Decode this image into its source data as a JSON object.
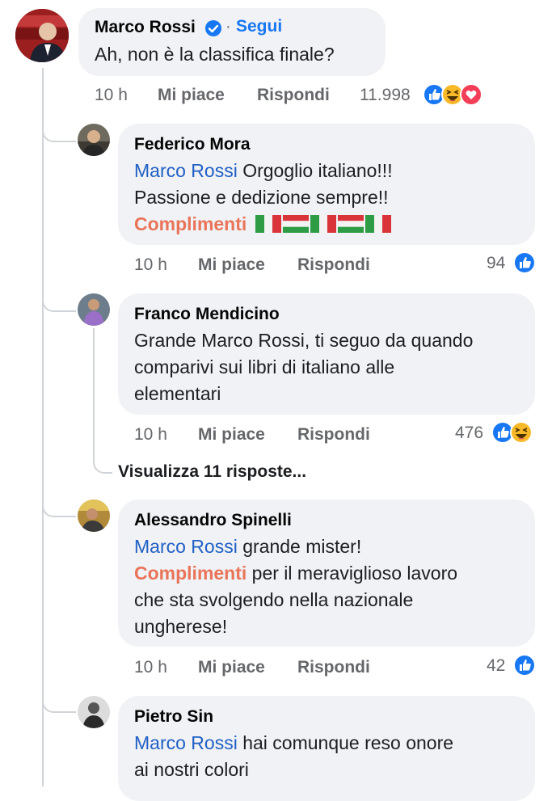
{
  "main_comment": {
    "author": "Marco Rossi",
    "dot": "·",
    "follow_label": "Segui",
    "text": "Ah, non è la classifica finale?",
    "time": "10 h",
    "like_label": "Mi piace",
    "reply_label": "Rispondi",
    "reactions_count": "11.998",
    "reactions": [
      "like-icon",
      "haha-icon",
      "love-icon"
    ]
  },
  "replies": [
    {
      "author": "Federico Mora",
      "mention": "Marco Rossi",
      "text_line1": " Orgoglio italiano!!!",
      "text_line2": "Passione e dedizione sempre!!",
      "highlight": "Complimenti",
      "time": "10 h",
      "like_label": "Mi piace",
      "reply_label": "Rispondi",
      "reactions_count": "94",
      "reactions": [
        "like-icon"
      ]
    },
    {
      "author": "Franco Mendicino",
      "text_line1": "Grande Marco Rossi, ti seguo da quando",
      "text_line2": "comparivi sui libri di italiano alle",
      "text_line3": "elementari",
      "time": "10 h",
      "like_label": "Mi piace",
      "reply_label": "Rispondi",
      "reactions_count": "476",
      "reactions": [
        "like-icon",
        "haha-icon"
      ],
      "view_replies_label": "Visualizza 11 risposte..."
    },
    {
      "author": "Alessandro Spinelli",
      "mention": "Marco Rossi",
      "text_line1": " grande mister!",
      "highlight": "Complimenti",
      "text_line2": " per il meraviglioso lavoro",
      "text_line3": "che sta svolgendo nella nazionale",
      "text_line4": "ungherese!",
      "time": "10 h",
      "like_label": "Mi piace",
      "reply_label": "Rispondi",
      "reactions_count": "42",
      "reactions": [
        "like-icon"
      ]
    },
    {
      "author": "Pietro Sin",
      "mention": "Marco Rossi",
      "text_line1": " hai comunque reso onore",
      "text_line2": "ai nostri colori"
    }
  ],
  "colors": {
    "mention": "#2160c4",
    "highlight": "#e9745a",
    "bubble": "#f0f2f5",
    "verified": "#1877f2"
  }
}
